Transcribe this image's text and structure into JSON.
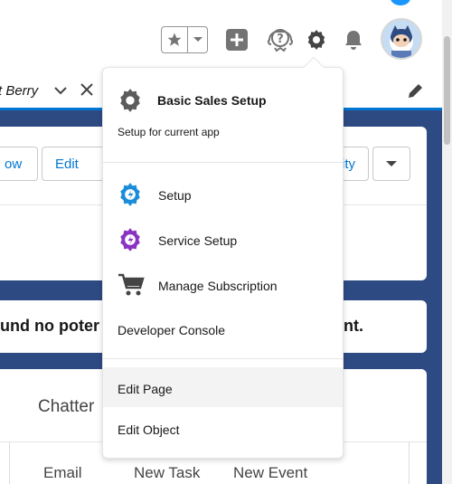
{
  "header": {
    "favorites_icon": "star-icon",
    "icons": [
      "plus-square-icon",
      "help-icon",
      "gear-icon",
      "bell-icon",
      "avatar"
    ]
  },
  "tabbar": {
    "current_tab_label": "t Berry"
  },
  "record": {
    "buttons": [
      "ow",
      "Edit",
      "ity"
    ]
  },
  "alert": {
    "text": "und no poter"
  },
  "alert_tail": "nt.",
  "tabs": {
    "chatter": "Chatter"
  },
  "actions": [
    "Email",
    "New Task",
    "New Event"
  ],
  "setup_menu": {
    "title": "Basic Sales Setup",
    "subtitle": "Setup for current app",
    "items": [
      {
        "label": "Setup",
        "icon": "setup-gear-icon"
      },
      {
        "label": "Service Setup",
        "icon": "service-setup-gear-icon"
      },
      {
        "label": "Manage Subscription",
        "icon": "cart-icon"
      },
      {
        "label": "Developer Console",
        "icon": ""
      },
      {
        "label": "Edit Page",
        "icon": ""
      },
      {
        "label": "Edit Object",
        "icon": ""
      }
    ]
  },
  "colors": {
    "brand_blue": "#0176d3",
    "setup_icon": "#1b8dd8",
    "service_setup_icon": "#8a33c2",
    "content_background": "#2d4a82"
  }
}
